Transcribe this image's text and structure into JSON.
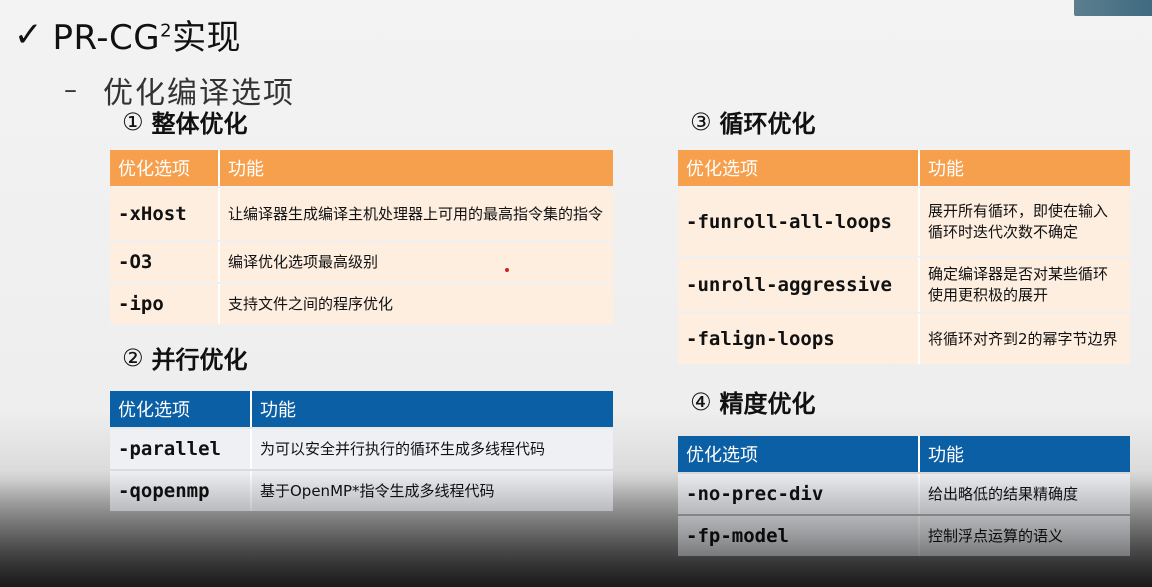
{
  "title": {
    "main": "PR-CG",
    "sup": "2",
    "suffix": "实现"
  },
  "subtitle": "优化编译选项",
  "header_labels": {
    "option": "优化选项",
    "function": "功能"
  },
  "sections": [
    {
      "num": "①",
      "heading": "整体优化",
      "rows": [
        {
          "option": "-xHost",
          "desc": "让编译器生成编译主机处理器上可用的最高指令集的指令"
        },
        {
          "option": "-O3",
          "desc": "编译优化选项最高级别"
        },
        {
          "option": "-ipo",
          "desc": "支持文件之间的程序优化"
        }
      ]
    },
    {
      "num": "②",
      "heading": "并行优化",
      "rows": [
        {
          "option": "-parallel",
          "desc": "为可以安全并行执行的循环生成多线程代码"
        },
        {
          "option": "-qopenmp",
          "desc": "基于OpenMP*指令生成多线程代码"
        }
      ]
    },
    {
      "num": "③",
      "heading": "循环优化",
      "rows": [
        {
          "option": "-funroll-all-loops",
          "desc": "展开所有循环，即使在输入循环时迭代次数不确定"
        },
        {
          "option": "-unroll-aggressive",
          "desc": "确定编译器是否对某些循环使用更积极的展开"
        },
        {
          "option": "-falign-loops",
          "desc": "将循环对齐到2的幂字节边界"
        }
      ]
    },
    {
      "num": "④",
      "heading": "精度优化",
      "rows": [
        {
          "option": "-no-prec-div",
          "desc": "给出略低的结果精确度"
        },
        {
          "option": "-fp-model",
          "desc": "控制浮点运算的语义"
        }
      ]
    }
  ],
  "icons": {
    "check": "checkmark-icon",
    "dash": "dash-bullet-icon"
  },
  "colors": {
    "orange_header": "#f6a04d",
    "blue_header": "#0b5fa5",
    "orange_row": "#fdeee0",
    "blue_row": "#eef0f4"
  }
}
